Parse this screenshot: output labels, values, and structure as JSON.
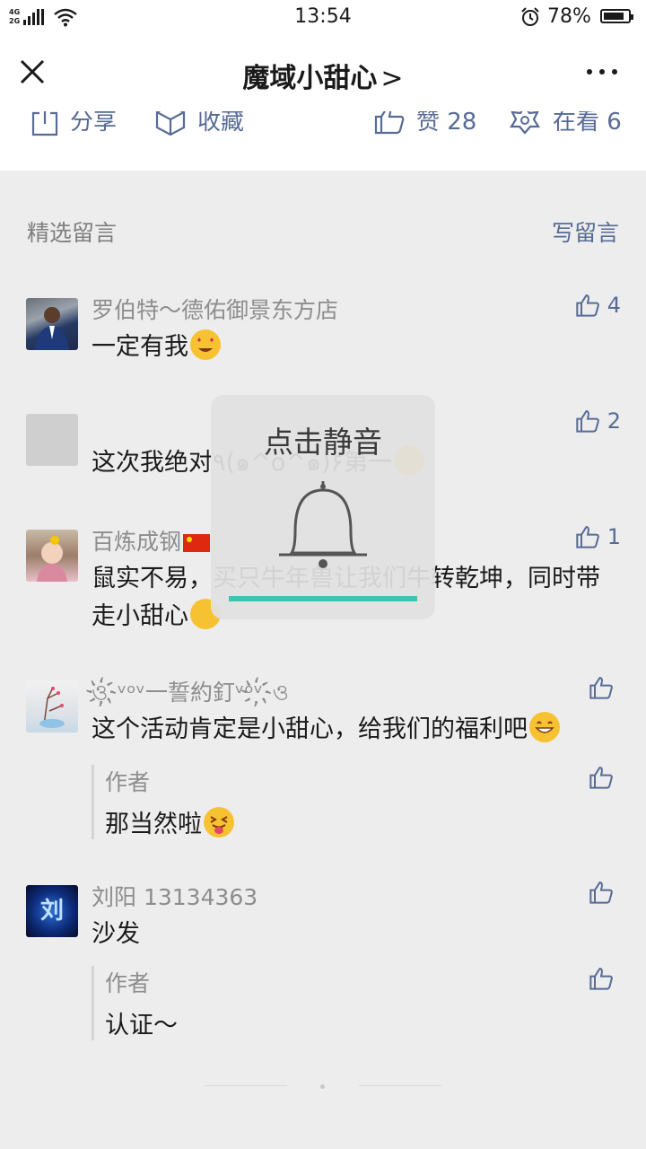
{
  "status_bar": {
    "network_top": "4G",
    "network_bottom": "2G",
    "time": "13:54",
    "battery": "78%"
  },
  "nav": {
    "title": "魔域小甜心",
    "title_chevron": ">"
  },
  "actions": {
    "share": "分享",
    "favorite": "收藏",
    "like": "赞 28",
    "watching": "在看 6"
  },
  "comments_section": {
    "title": "精选留言",
    "write": "写留言"
  },
  "comments": [
    {
      "name": "罗伯特～德佑御景东方店",
      "text": "一定有我",
      "likes": "4",
      "emoji": "star-eyes"
    },
    {
      "name": "",
      "text": "这次我绝对٩(๑^ο^๑)۶第一",
      "likes": "2",
      "emoji": "sweat"
    },
    {
      "name": "百炼成钢",
      "text": "鼠实不易，买只牛年兽让我们牛转乾坤，同时带走小甜心",
      "likes": "1",
      "emoji": "grin"
    },
    {
      "name": "ও҉ᵛᵒᵛ一誓約釘ᵛᵒᵛ҉ও",
      "text": "这个活动肯定是小甜心，给我们的福利吧",
      "likes": "",
      "emoji": "smile",
      "reply": {
        "name": "作者",
        "text": "那当然啦"
      }
    },
    {
      "name": "刘阳 13134363",
      "text": "沙发",
      "likes": "",
      "reply": {
        "name": "作者",
        "text": "认证～"
      }
    }
  ],
  "mute_overlay": {
    "title": "点击静音"
  },
  "avatar_glyph": "刘",
  "colors": {
    "link": "#576b95",
    "progress": "#3fc4b2",
    "background": "#ededed"
  }
}
